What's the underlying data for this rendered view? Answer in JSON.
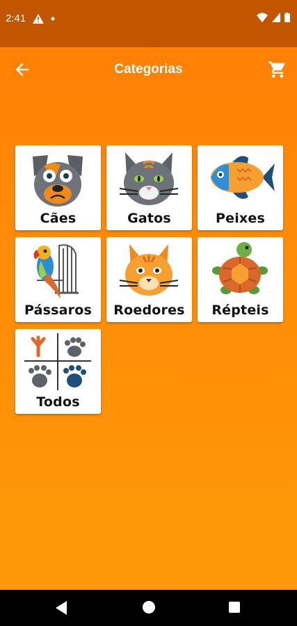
{
  "status_bar": {
    "time": "2:41"
  },
  "app_bar": {
    "title": "Categorias"
  },
  "categories": [
    {
      "label": "Cães",
      "icon": "dog-icon"
    },
    {
      "label": "Gatos",
      "icon": "cat-icon"
    },
    {
      "label": "Peixes",
      "icon": "fish-icon"
    },
    {
      "label": "Pássaros",
      "icon": "parrot-icon"
    },
    {
      "label": "Roedores",
      "icon": "rodent-icon"
    },
    {
      "label": "Répteis",
      "icon": "turtle-icon"
    },
    {
      "label": "Todos",
      "icon": "all-paws-icon"
    }
  ],
  "colors": {
    "background": "#ff8c07",
    "status_bar": "#c25500",
    "card": "#ffffff"
  }
}
